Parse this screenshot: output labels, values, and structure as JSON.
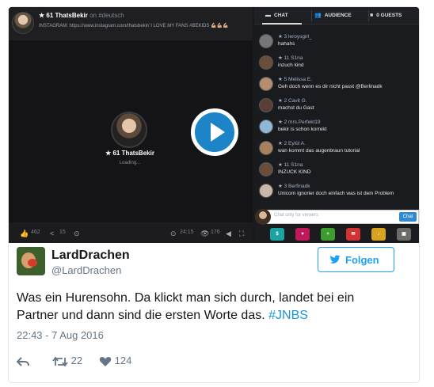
{
  "stream": {
    "user_line": "★ 61 ThatsBekir",
    "channel": "on #deutsch",
    "description": "INSTAGRAM: https://www.instagram.com/thatsbekir/ I LOVE MY FANS #BEKIDS 💪🏼💪🏼💪🏼",
    "center_name": "★ 61 ThatsBekir",
    "loading": "Loading...",
    "likes": "462",
    "shares": "15",
    "duration": "24:15",
    "viewers": "176"
  },
  "chat": {
    "tabs": [
      {
        "label": "CHAT",
        "icon": "chat-icon"
      },
      {
        "label": "AUDIENCE",
        "icon": "audience-icon"
      },
      {
        "label": "0 GUESTS",
        "icon": "camera-icon"
      }
    ],
    "messages": [
      {
        "user": "★ 3 leroysgirl_",
        "text": "hahahs"
      },
      {
        "user": "★ 11 S1na",
        "text": "inzuch kind"
      },
      {
        "user": "★ 5 Melissa E.",
        "text": "Geh doch wenn es dir nicht passt @Berlinadk"
      },
      {
        "user": "★ 2 Cavit G.",
        "text": "machst du Gast"
      },
      {
        "user": "★ 2 mrs.Perfekt19",
        "text": "bekir is schon korrekt"
      },
      {
        "user": "★ 2 Eylül A.",
        "text": "wan kommt das augenbraun tutorial"
      },
      {
        "user": "★ 11 S1na",
        "text": "INZUCK KIND"
      },
      {
        "user": "★ 3 Berfinadk",
        "text": "Unicorn ignorier doch einfach was ist dein Problem"
      }
    ],
    "input_placeholder": "Chat only for viewers",
    "send_label": "Chat"
  },
  "tweet": {
    "author_name": "LardDrachen",
    "handle": "@LardDrachen",
    "follow_label": "Folgen",
    "text_main": "Was ein Hurensohn. Da klickt man sich durch, landet bei ein Partner und dann sind die ersten Worte das.",
    "hashtag": "#JNBS",
    "timestamp": "22:43 - 7 Aug 2016",
    "retweets": "22",
    "likes": "124"
  },
  "colors": {
    "twitter_blue": "#1da1f2",
    "play_blue": "#1d84c8",
    "text": "#14171a",
    "muted": "#657786"
  }
}
